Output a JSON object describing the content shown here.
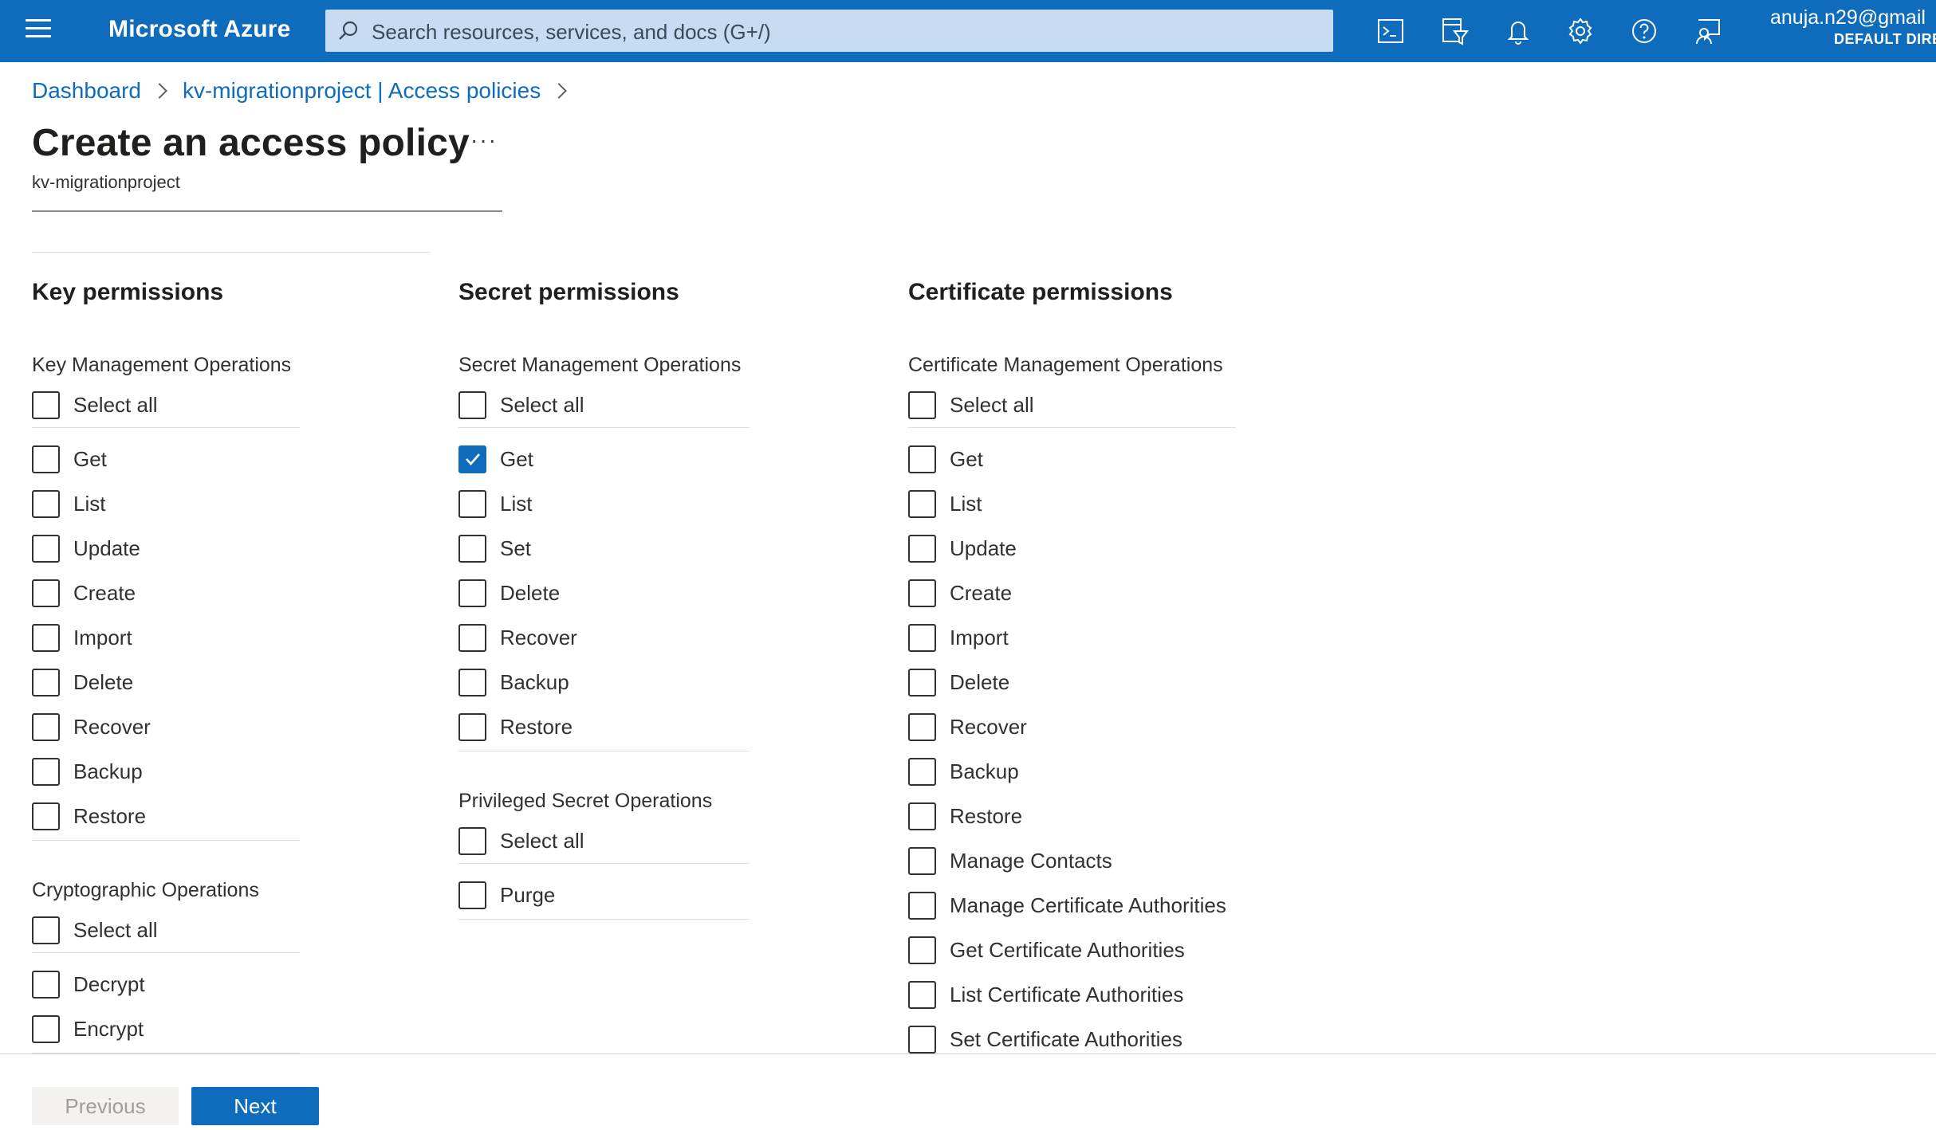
{
  "topbar": {
    "brand": "Microsoft Azure",
    "search_placeholder": "Search resources, services, and docs (G+/)",
    "icons": [
      "cloud-shell-icon",
      "directory-filter-icon",
      "notifications-bell-icon",
      "settings-gear-icon",
      "help-question-icon",
      "feedback-icon"
    ],
    "account_email": "anuja.n29@gmail",
    "account_directory": "DEFAULT DIRE"
  },
  "breadcrumb": [
    "Dashboard",
    "kv-migrationproject | Access policies"
  ],
  "page": {
    "title": "Create an access policy",
    "more": "···",
    "subtitle": "kv-migrationproject"
  },
  "key_permissions": {
    "heading": "Key permissions",
    "management": {
      "title": "Key Management Operations",
      "select_all": "Select all",
      "items": [
        "Get",
        "List",
        "Update",
        "Create",
        "Import",
        "Delete",
        "Recover",
        "Backup",
        "Restore"
      ]
    },
    "crypto": {
      "title": "Cryptographic Operations",
      "select_all": "Select all",
      "items": [
        "Decrypt",
        "Encrypt"
      ]
    }
  },
  "secret_permissions": {
    "heading": "Secret permissions",
    "management": {
      "title": "Secret Management Operations",
      "select_all": "Select all",
      "items": [
        "Get",
        "List",
        "Set",
        "Delete",
        "Recover",
        "Backup",
        "Restore"
      ],
      "checked": [
        "Get"
      ]
    },
    "privileged": {
      "title": "Privileged Secret Operations",
      "select_all": "Select all",
      "items": [
        "Purge"
      ]
    }
  },
  "certificate_permissions": {
    "heading": "Certificate permissions",
    "management": {
      "title": "Certificate Management Operations",
      "select_all": "Select all",
      "items": [
        "Get",
        "List",
        "Update",
        "Create",
        "Import",
        "Delete",
        "Recover",
        "Backup",
        "Restore",
        "Manage Contacts",
        "Manage Certificate Authorities",
        "Get Certificate Authorities",
        "List Certificate Authorities",
        "Set Certificate Authorities"
      ]
    }
  },
  "footer": {
    "previous": "Previous",
    "next": "Next"
  },
  "colors": {
    "accent": "#0f6cbd",
    "search_bg": "#c7dcf3"
  }
}
